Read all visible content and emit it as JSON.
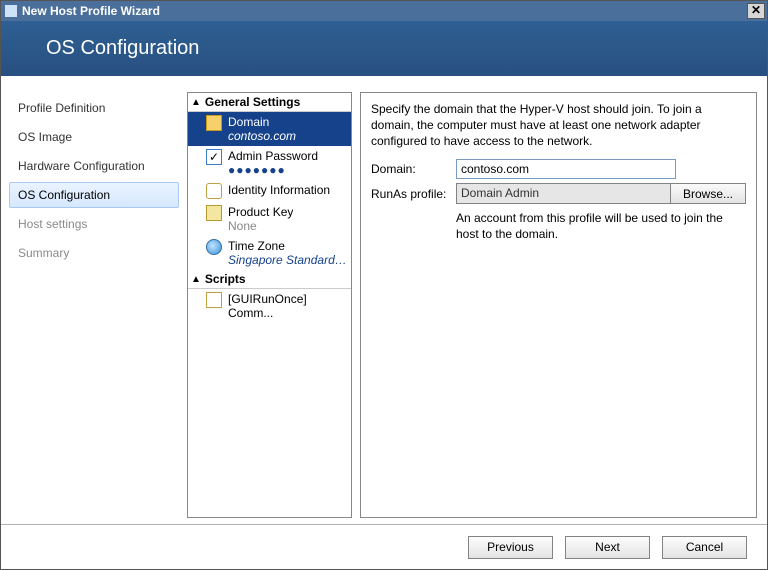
{
  "window": {
    "title": "New Host Profile Wizard"
  },
  "banner": {
    "heading": "OS Configuration"
  },
  "nav": {
    "items": [
      {
        "label": "Profile Definition",
        "state": "normal"
      },
      {
        "label": "OS Image",
        "state": "normal"
      },
      {
        "label": "Hardware Configuration",
        "state": "normal"
      },
      {
        "label": "OS Configuration",
        "state": "selected"
      },
      {
        "label": "Host settings",
        "state": "disabled"
      },
      {
        "label": "Summary",
        "state": "disabled"
      }
    ]
  },
  "tree": {
    "sections": [
      {
        "header": "General Settings",
        "items": [
          {
            "icon": "domain-icon",
            "label": "Domain",
            "value": "contoso.com",
            "selected": true
          },
          {
            "icon": "password-icon",
            "label": "Admin Password",
            "value": "●●●●●●●",
            "selected": false
          },
          {
            "icon": "identity-icon",
            "label": "Identity Information",
            "value": "",
            "selected": false
          },
          {
            "icon": "product-key-icon",
            "label": "Product Key",
            "value": "None",
            "selected": false
          },
          {
            "icon": "timezone-icon",
            "label": "Time Zone",
            "value": "Singapore Standard ...",
            "selected": false
          }
        ]
      },
      {
        "header": "Scripts",
        "items": [
          {
            "icon": "script-icon",
            "label": "[GUIRunOnce] Comm...",
            "value": "",
            "selected": false
          }
        ]
      }
    ]
  },
  "detail": {
    "instructions": "Specify the domain that the Hyper-V host should join. To join a domain, the computer must have at least one network adapter configured to have access to the network.",
    "domain_label": "Domain:",
    "domain_value": "contoso.com",
    "runas_label": "RunAs profile:",
    "runas_value": "Domain Admin",
    "browse_label": "Browse...",
    "hint": "An account from this profile will be used to join the host to the domain."
  },
  "footer": {
    "previous": "Previous",
    "next": "Next",
    "cancel": "Cancel"
  }
}
